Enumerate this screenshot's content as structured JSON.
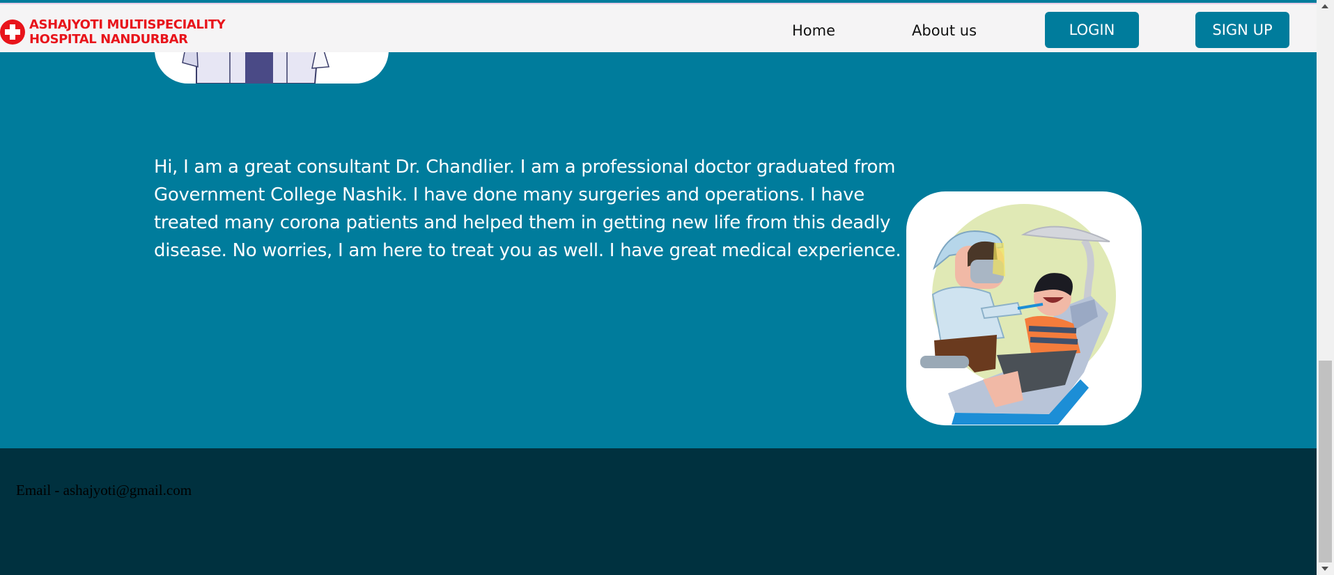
{
  "header": {
    "logo_text": "ASHAJYOTI MULTISPECIALITY\nHOSPITAL NANDURBAR",
    "logo_icon": "red-cross-icon",
    "nav": {
      "home": "Home",
      "about": "About us",
      "login": "LOGIN",
      "signup": "SIGN UP"
    }
  },
  "doctor": {
    "bio": "Hi, I am a great consultant Dr. Chandlier. I am a professional doctor graduated from Government College Nashik. I have done many surgeries and operations. I have treated many corona patients and helped them in getting new life from this deadly disease. No worries, I am here to treat you as well. I have great medical experience."
  },
  "footer": {
    "email": "Email - ashajyoti@gmail.com"
  },
  "colors": {
    "brand_red": "#e8141b",
    "teal": "#007c9c",
    "footer_bg": "#00313f",
    "header_bg": "#f5f4f5"
  }
}
